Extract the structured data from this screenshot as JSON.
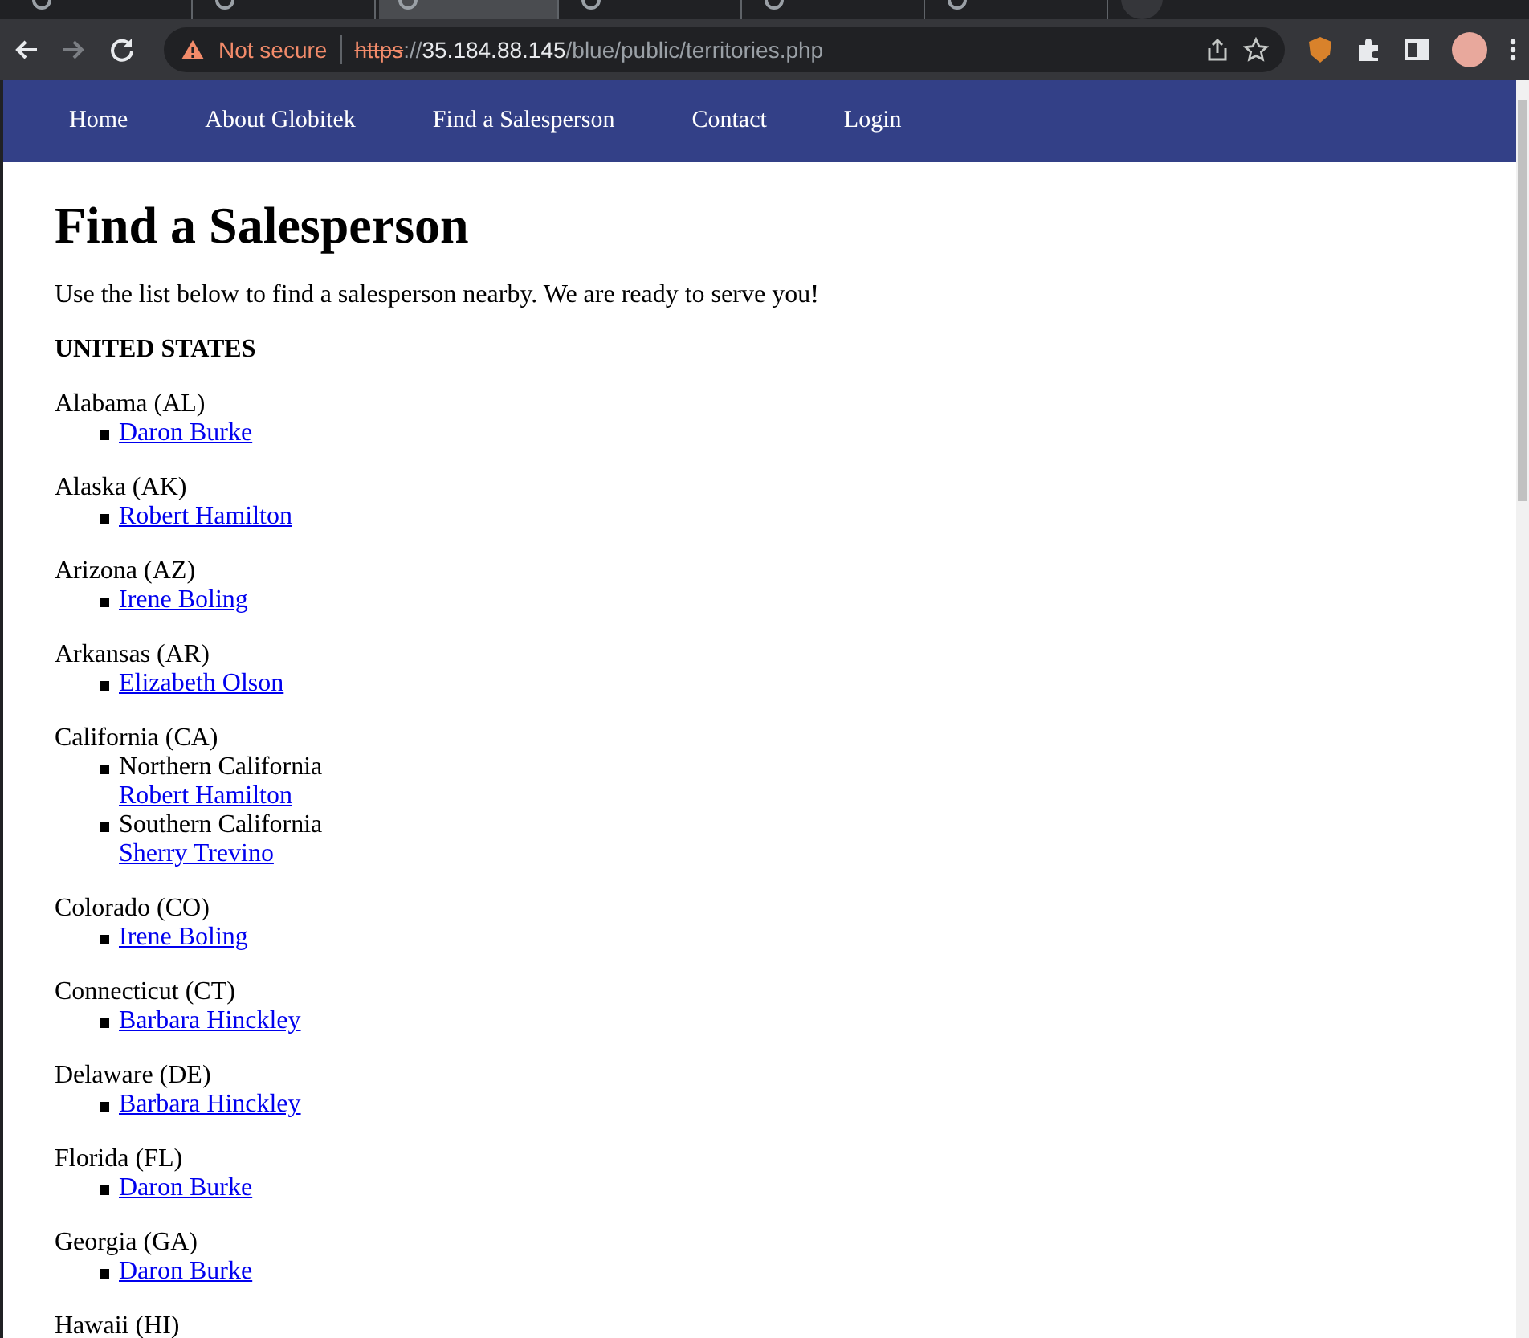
{
  "browser": {
    "tabs": [
      {
        "selected": false
      },
      {
        "selected": false
      },
      {
        "selected": true
      },
      {
        "selected": false
      },
      {
        "selected": false
      },
      {
        "selected": false
      }
    ],
    "security": "Not secure",
    "url": {
      "scheme": "https",
      "separator": "://",
      "host": "35.184.88.145",
      "path": "/blue/public/territories.php"
    }
  },
  "nav": {
    "items": [
      "Home",
      "About Globitek",
      "Find a Salesperson",
      "Contact",
      "Login"
    ]
  },
  "page": {
    "title": "Find a Salesperson",
    "intro": "Use the list below to find a salesperson nearby. We are ready to serve you!",
    "country": "UNITED STATES",
    "states": [
      {
        "name": "Alabama (AL)",
        "entries": [
          {
            "person": "Daron Burke"
          }
        ]
      },
      {
        "name": "Alaska (AK)",
        "entries": [
          {
            "person": "Robert Hamilton"
          }
        ]
      },
      {
        "name": "Arizona (AZ)",
        "entries": [
          {
            "person": "Irene Boling"
          }
        ]
      },
      {
        "name": "Arkansas (AR)",
        "entries": [
          {
            "person": "Elizabeth Olson"
          }
        ]
      },
      {
        "name": "California (CA)",
        "entries": [
          {
            "region": "Northern California",
            "person": "Robert Hamilton"
          },
          {
            "region": "Southern California",
            "person": "Sherry Trevino"
          }
        ]
      },
      {
        "name": "Colorado (CO)",
        "entries": [
          {
            "person": "Irene Boling"
          }
        ]
      },
      {
        "name": "Connecticut (CT)",
        "entries": [
          {
            "person": "Barbara Hinckley"
          }
        ]
      },
      {
        "name": "Delaware (DE)",
        "entries": [
          {
            "person": "Barbara Hinckley"
          }
        ]
      },
      {
        "name": "Florida (FL)",
        "entries": [
          {
            "person": "Daron Burke"
          }
        ]
      },
      {
        "name": "Georgia (GA)",
        "entries": [
          {
            "person": "Daron Burke"
          }
        ]
      },
      {
        "name": "Hawaii (HI)"
      }
    ]
  }
}
